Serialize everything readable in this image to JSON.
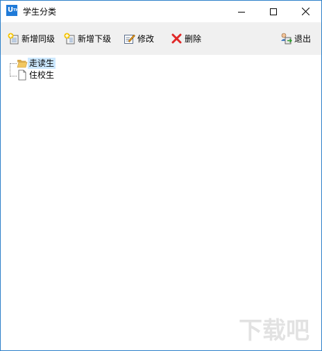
{
  "window": {
    "title": "学生分类",
    "app_icon_text": "U",
    "app_icon_sub": "TH"
  },
  "toolbar": {
    "items": [
      {
        "label": "新增同级",
        "icon": "add-sibling-icon"
      },
      {
        "label": "新增下级",
        "icon": "add-child-icon"
      },
      {
        "label": "修改",
        "icon": "edit-icon"
      },
      {
        "label": "删除",
        "icon": "delete-icon"
      },
      {
        "label": "退出",
        "icon": "exit-icon"
      }
    ]
  },
  "tree": {
    "nodes": [
      {
        "label": "走读生",
        "icon": "open-folder-icon",
        "selected": true
      },
      {
        "label": "住校生",
        "icon": "document-icon",
        "selected": false
      }
    ]
  },
  "watermark": {
    "text": "下载吧"
  },
  "colors": {
    "window_border": "#2b7fc9",
    "toolbar_bg": "#f0f0f0",
    "selection_bg": "#cce8ff",
    "delete_red": "#e02828"
  }
}
